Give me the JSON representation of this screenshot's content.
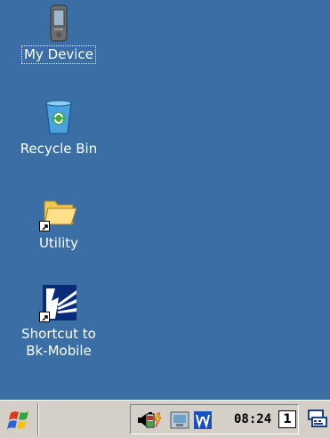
{
  "desktop": {
    "icons": [
      {
        "label": "My Device"
      },
      {
        "label": "Recycle Bin"
      },
      {
        "label": "Utility"
      },
      {
        "label": "Shortcut to\nBk-Mobile"
      }
    ]
  },
  "taskbar": {
    "start_icon": "windows-flag-icon",
    "tray_icons": [
      "volume-icon",
      "battery-charging-icon",
      "network-icon",
      "word-icon"
    ],
    "clock": "08:24",
    "input_indicator": "1",
    "input_panel_icon": "keyboard-icon"
  },
  "colors": {
    "desktop": "#3a6ea5",
    "taskbar": "#d4d0c8"
  }
}
